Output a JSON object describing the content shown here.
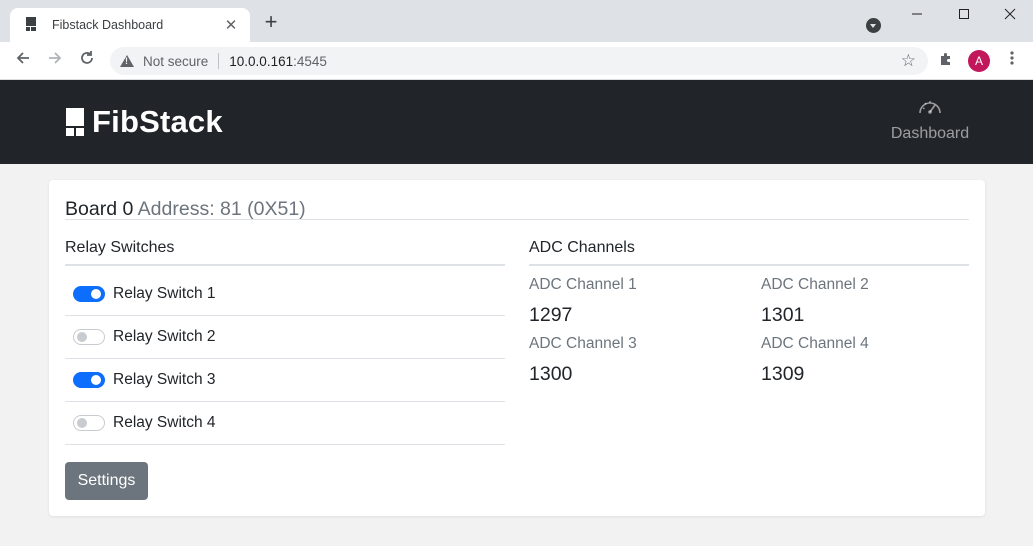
{
  "browser": {
    "tab_title": "Fibstack Dashboard",
    "tab_close": "✕",
    "new_tab": "+",
    "not_secure": "Not secure",
    "url_host": "10.0.0.161",
    "url_port": ":4545",
    "avatar_letter": "A"
  },
  "app": {
    "brand": "FibStack",
    "nav": {
      "dashboard_label": "Dashboard"
    },
    "board": {
      "name": "Board 0",
      "address": "Address: 81 (0X51)"
    },
    "relays": {
      "title": "Relay Switches",
      "items": [
        {
          "label": "Relay Switch 1",
          "on": true
        },
        {
          "label": "Relay Switch 2",
          "on": false
        },
        {
          "label": "Relay Switch 3",
          "on": true
        },
        {
          "label": "Relay Switch 4",
          "on": false
        }
      ],
      "settings_label": "Settings"
    },
    "adc": {
      "title": "ADC Channels",
      "channels": [
        {
          "name": "ADC Channel 1",
          "value": "1297"
        },
        {
          "name": "ADC Channel 2",
          "value": "1301"
        },
        {
          "name": "ADC Channel 3",
          "value": "1300"
        },
        {
          "name": "ADC Channel 4",
          "value": "1309"
        }
      ]
    }
  },
  "colors": {
    "switch_on": "#0d6efd",
    "navbar": "#212529",
    "settings_button": "#6c757d"
  },
  "icons": {
    "back": "arrow-left-icon",
    "forward": "arrow-right-icon",
    "reload": "reload-icon",
    "dashboard": "speedometer-icon"
  }
}
